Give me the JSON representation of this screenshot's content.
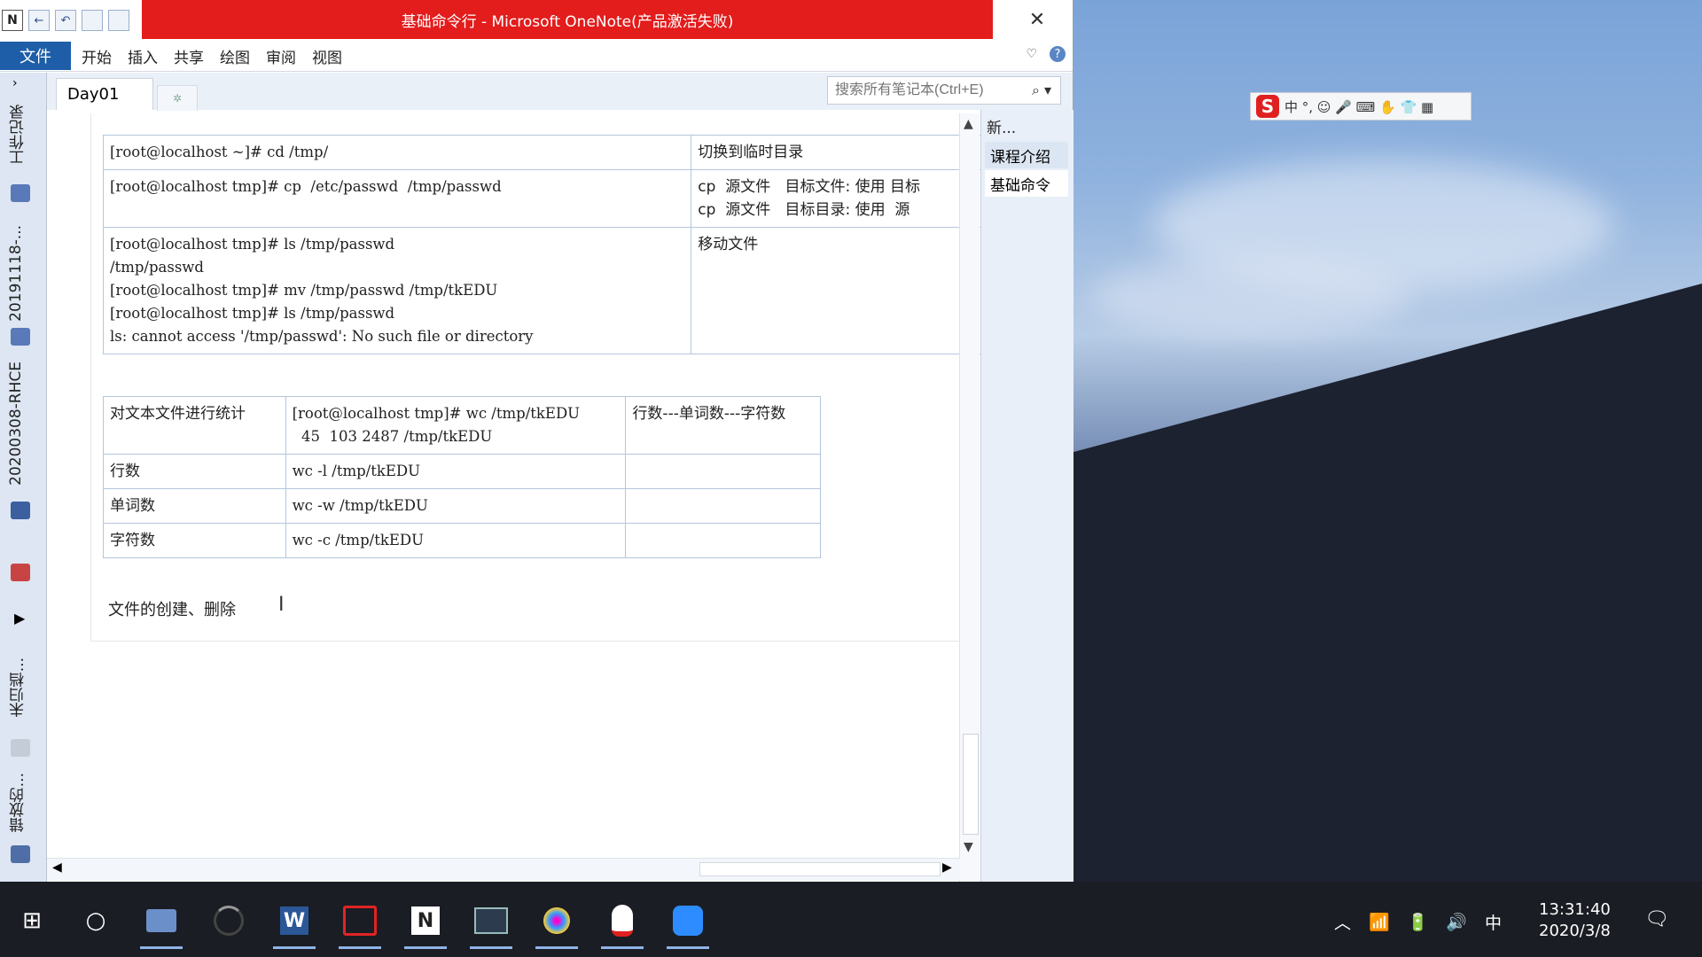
{
  "window": {
    "title": "基础命令行 - Microsoft OneNote(产品激活失败)",
    "close_glyph": "✕",
    "qat_logo": "N",
    "qat_back": "←",
    "qat_undo": "↶"
  },
  "menu": {
    "file": "文件",
    "items": [
      "开始",
      "插入",
      "共享",
      "绘图",
      "审阅",
      "视图"
    ],
    "expand_glyph": "♡",
    "help_glyph": "?"
  },
  "notebooks": [
    "工作记录",
    "20191118-...",
    "20200308-RHCE",
    "未归档...",
    "错放的..."
  ],
  "section_tab": "Day01",
  "new_tab_glyph": "✲",
  "search": {
    "placeholder": "搜索所有笔记本(Ctrl+E)",
    "icon": "⌕ ▾"
  },
  "page_list": {
    "new_page": "新...",
    "pages": [
      "课程介绍",
      "基础命令"
    ]
  },
  "table1": {
    "rows": [
      {
        "cmd": "[root@localhost ~]# cd /tmp/",
        "desc": "切换到临时目录"
      },
      {
        "cmd": "[root@localhost tmp]# cp  /etc/passwd  /tmp/passwd",
        "desc": "cp  源文件   目标文件: 使用 目标\ncp  源文件   目标目录: 使用  源"
      },
      {
        "cmd": "[root@localhost tmp]# ls /tmp/passwd\n/tmp/passwd\n[root@localhost tmp]# mv /tmp/passwd /tmp/tkEDU\n[root@localhost tmp]# ls /tmp/passwd\nls: cannot access '/tmp/passwd': No such file or directory",
        "desc": "移动文件"
      }
    ]
  },
  "table2": {
    "rows": [
      {
        "label": "对文本文件进行统计",
        "cmd": "[root@localhost tmp]# wc /tmp/tkEDU\n  45  103 2487 /tmp/tkEDU",
        "note": "行数---单词数---字符数"
      },
      {
        "label": "行数",
        "cmd": "wc -l /tmp/tkEDU",
        "note": ""
      },
      {
        "label": "单词数",
        "cmd": "wc -w /tmp/tkEDU",
        "note": ""
      },
      {
        "label": "字符数",
        "cmd": "wc -c /tmp/tkEDU",
        "note": ""
      }
    ]
  },
  "note_text": "文件的创建、删除",
  "ime": {
    "logo": "S",
    "items": "中 °, ☺ 🎤 ⌨ ✋ 👕 ▦"
  },
  "taskbar": {
    "start": "⊞",
    "search": "○",
    "apps": [
      "file-manager",
      "loading",
      "word",
      "remote-desktop",
      "onenote",
      "snip",
      "paint",
      "qq",
      "zoom"
    ],
    "tray": {
      "chevron": "︿",
      "wifi": "📶",
      "battery": "🔋",
      "volume": "🔊",
      "ime": "中"
    },
    "time": "13:31:40",
    "date": "2020/3/8",
    "notify": "🗨"
  }
}
